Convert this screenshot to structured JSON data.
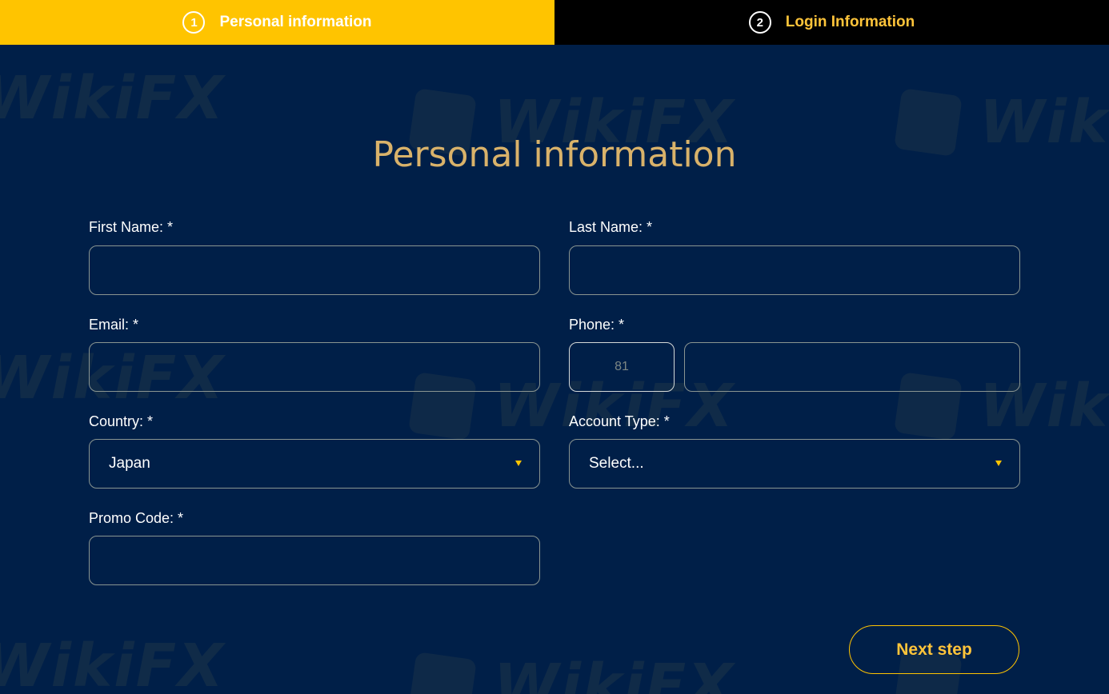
{
  "stepper": {
    "step1": {
      "number": "1",
      "label": "Personal information"
    },
    "step2": {
      "number": "2",
      "label": "Login Information"
    }
  },
  "title": "Personal information",
  "form": {
    "first_name": {
      "label": "First Name: *",
      "value": ""
    },
    "last_name": {
      "label": "Last Name: *",
      "value": ""
    },
    "email": {
      "label": "Email: *",
      "value": ""
    },
    "phone": {
      "label": "Phone: *",
      "country_code": "81",
      "value": ""
    },
    "country": {
      "label": "Country: *",
      "selected": "Japan"
    },
    "account_type": {
      "label": "Account Type: *",
      "selected": "Select..."
    },
    "promo_code": {
      "label": "Promo Code: *",
      "value": ""
    }
  },
  "next_button": "Next step",
  "watermark": "WikiFX",
  "colors": {
    "background": "#001f48",
    "active_step": "#ffc400",
    "inactive_step": "#000000",
    "accent": "#ffc43a",
    "title": "#d9b26a"
  }
}
